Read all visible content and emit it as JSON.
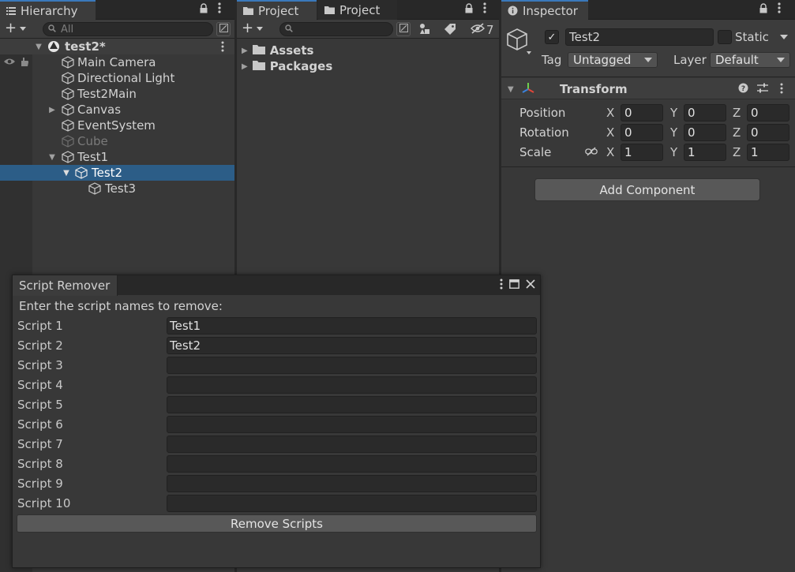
{
  "hierarchy": {
    "tab_label": "Hierarchy",
    "search_placeholder": "All",
    "scene_name": "test2*",
    "items": [
      {
        "label": "Main Camera"
      },
      {
        "label": "Directional Light"
      },
      {
        "label": "Test2Main"
      },
      {
        "label": "Canvas"
      },
      {
        "label": "EventSystem"
      },
      {
        "label": "Cube"
      },
      {
        "label": "Test1"
      },
      {
        "label": "Test2"
      },
      {
        "label": "Test3"
      }
    ]
  },
  "project": {
    "tab1_label": "Project",
    "tab2_label": "Project",
    "hidden_count": "7",
    "folders": [
      {
        "label": "Assets"
      },
      {
        "label": "Packages"
      }
    ]
  },
  "inspector": {
    "tab_label": "Inspector",
    "object_name": "Test2",
    "static_label": "Static",
    "tag_label": "Tag",
    "tag_value": "Untagged",
    "layer_label": "Layer",
    "layer_value": "Default",
    "component_title": "Transform",
    "rows": [
      {
        "label": "Position",
        "x": "0",
        "y": "0",
        "z": "0"
      },
      {
        "label": "Rotation",
        "x": "0",
        "y": "0",
        "z": "0"
      },
      {
        "label": "Scale",
        "x": "1",
        "y": "1",
        "z": "1"
      }
    ],
    "axis_x": "X",
    "axis_y": "Y",
    "axis_z": "Z",
    "add_component_label": "Add Component"
  },
  "script_remover": {
    "tab_label": "Script Remover",
    "intro": "Enter the script names to remove:",
    "scripts": [
      {
        "label": "Script 1",
        "value": "Test1"
      },
      {
        "label": "Script 2",
        "value": "Test2"
      },
      {
        "label": "Script 3",
        "value": ""
      },
      {
        "label": "Script 4",
        "value": ""
      },
      {
        "label": "Script 5",
        "value": ""
      },
      {
        "label": "Script 6",
        "value": ""
      },
      {
        "label": "Script 7",
        "value": ""
      },
      {
        "label": "Script 8",
        "value": ""
      },
      {
        "label": "Script 9",
        "value": ""
      },
      {
        "label": "Script 10",
        "value": ""
      }
    ],
    "remove_button_label": "Remove Scripts"
  },
  "colors": {
    "selection": "#2c5d87",
    "panel_bg": "#383838",
    "tab_accent": "#3a79bb"
  }
}
